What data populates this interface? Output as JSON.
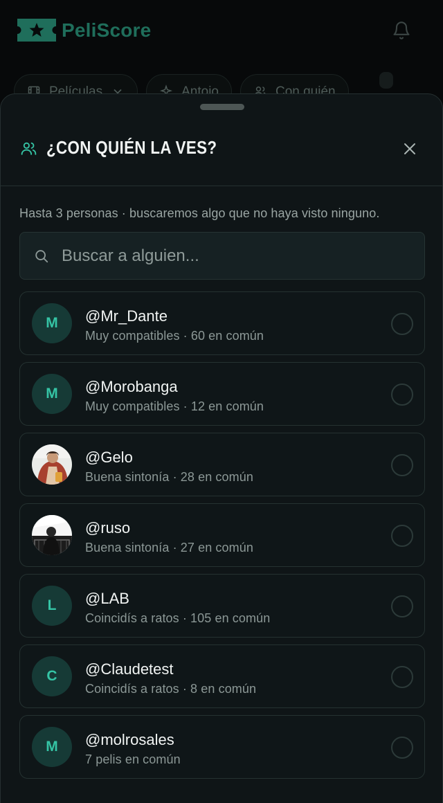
{
  "app": {
    "brand": "PeliScore",
    "logo_icon": "star-ticket-icon",
    "notification_icon": "bell-icon"
  },
  "filters": [
    {
      "label": "Películas",
      "icon": "film-icon",
      "trailing_icon": "chevron-down-icon"
    },
    {
      "label": "Antojo",
      "icon": "sparkle-icon"
    },
    {
      "label": "Con quién",
      "icon": "people-icon"
    }
  ],
  "modal": {
    "title": "¿CON QUIÉN LA VES?",
    "title_icon": "people-icon",
    "close_icon": "close-icon",
    "hint": "Hasta 3 personas · buscaremos algo que no haya visto ninguno.",
    "search": {
      "placeholder": "Buscar a alguien...",
      "value": ""
    },
    "people": [
      {
        "handle": "@Mr_Dante",
        "subtitle": "Muy compatibles · 60 en común",
        "initial": "M",
        "avatar": "initial",
        "selected": false
      },
      {
        "handle": "@Morobanga",
        "subtitle": "Muy compatibles · 12 en común",
        "initial": "M",
        "avatar": "initial",
        "selected": false
      },
      {
        "handle": "@Gelo",
        "subtitle": "Buena sintonía · 28 en común",
        "initial": "",
        "avatar": "photo",
        "selected": false
      },
      {
        "handle": "@ruso",
        "subtitle": "Buena sintonía · 27 en común",
        "initial": "",
        "avatar": "photo",
        "selected": false
      },
      {
        "handle": "@LAB",
        "subtitle": "Coincidís a ratos · 105 en común",
        "initial": "L",
        "avatar": "initial",
        "selected": false
      },
      {
        "handle": "@Claudetest",
        "subtitle": "Coincidís a ratos · 8 en común",
        "initial": "C",
        "avatar": "initial",
        "selected": false
      },
      {
        "handle": "@molrosales",
        "subtitle": "7 pelis en común",
        "initial": "M",
        "avatar": "initial",
        "selected": false
      }
    ]
  },
  "colors": {
    "accent": "#35c4a5",
    "brand": "#1f6e5b",
    "sheet_bg": "#0f1517",
    "avatar_bg": "#163a36"
  }
}
